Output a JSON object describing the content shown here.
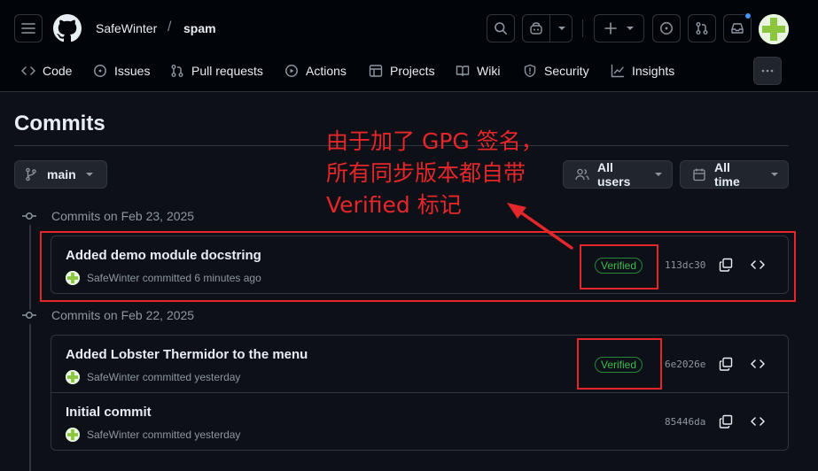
{
  "header": {
    "owner": "SafeWinter",
    "separator": "/",
    "repo": "spam"
  },
  "repo_nav": [
    {
      "key": "code",
      "label": "Code",
      "icon": "code-icon"
    },
    {
      "key": "issues",
      "label": "Issues",
      "icon": "issue-opened-icon"
    },
    {
      "key": "pulls",
      "label": "Pull requests",
      "icon": "git-pull-request-icon"
    },
    {
      "key": "actions",
      "label": "Actions",
      "icon": "play-icon"
    },
    {
      "key": "projects",
      "label": "Projects",
      "icon": "table-icon"
    },
    {
      "key": "wiki",
      "label": "Wiki",
      "icon": "book-icon"
    },
    {
      "key": "security",
      "label": "Security",
      "icon": "shield-icon"
    },
    {
      "key": "insights",
      "label": "Insights",
      "icon": "graph-icon"
    }
  ],
  "page": {
    "title": "Commits",
    "branch": "main",
    "users_filter": "All users",
    "time_filter": "All time"
  },
  "groups": [
    {
      "heading": "Commits on Feb 23, 2025",
      "commits": [
        {
          "message": "Added demo module docstring",
          "author": "SafeWinter",
          "meta": "committed 6 minutes ago",
          "verified": "Verified",
          "sha": "113dc30"
        }
      ]
    },
    {
      "heading": "Commits on Feb 22, 2025",
      "commits": [
        {
          "message": "Added Lobster Thermidor to the menu",
          "author": "SafeWinter",
          "meta": "committed yesterday",
          "verified": "Verified",
          "sha": "6e2026e"
        },
        {
          "message": "Initial commit",
          "author": "SafeWinter",
          "meta": "committed yesterday",
          "verified": "",
          "sha": "85446da"
        }
      ]
    }
  ],
  "annotation": {
    "line1": "由于加了 GPG 签名，",
    "line2": "所有同步版本都自带",
    "line3": "Verified 标记",
    "color": "#e5262a"
  },
  "colors": {
    "background": "#0d1117",
    "header": "#010409",
    "border": "#30363d",
    "verified_green": "#3fb950",
    "accent_blue": "#4493f8"
  }
}
